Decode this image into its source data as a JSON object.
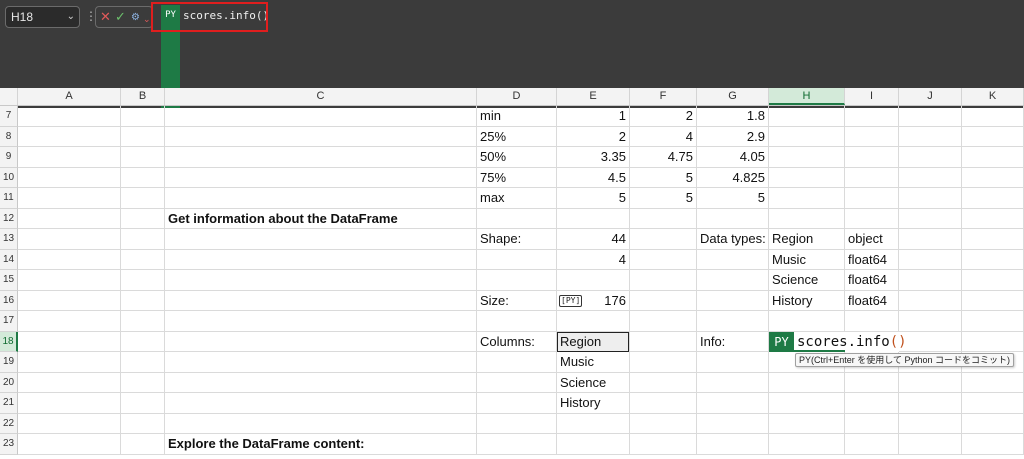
{
  "formula_bar": {
    "name_box": "H18",
    "py_badge": "PY",
    "formula": "scores.info()"
  },
  "columns": [
    "A",
    "B",
    "C",
    "D",
    "E",
    "F",
    "G",
    "H",
    "I",
    "J",
    "K"
  ],
  "selected_column": "H",
  "rows": [
    {
      "num": "7",
      "cells": {
        "D": "min",
        "E": "1",
        "F": "2",
        "G": "1.8"
      }
    },
    {
      "num": "8",
      "cells": {
        "D": "25%",
        "E": "2",
        "F": "4",
        "G": "2.9"
      }
    },
    {
      "num": "9",
      "cells": {
        "D": "50%",
        "E": "3.35",
        "F": "4.75",
        "G": "4.05"
      }
    },
    {
      "num": "10",
      "cells": {
        "D": "75%",
        "E": "4.5",
        "F": "5",
        "G": "4.825"
      }
    },
    {
      "num": "11",
      "cells": {
        "D": "max",
        "E": "5",
        "F": "5",
        "G": "5"
      }
    },
    {
      "num": "12",
      "cells": {
        "C": "Get information about the DataFrame"
      }
    },
    {
      "num": "13",
      "cells": {
        "D": "Shape:",
        "E": "44",
        "G": "Data types:",
        "H": "Region",
        "I": "object"
      }
    },
    {
      "num": "14",
      "cells": {
        "E": "4",
        "H": "Music",
        "I": "float64"
      }
    },
    {
      "num": "15",
      "cells": {
        "H": "Science",
        "I": "float64"
      }
    },
    {
      "num": "16",
      "cells": {
        "D": "Size:",
        "E": "176",
        "H": "History",
        "I": "float64"
      }
    },
    {
      "num": "17",
      "cells": {}
    },
    {
      "num": "18",
      "cells": {
        "D": "Columns:",
        "E": "Region",
        "G": "Info:"
      }
    },
    {
      "num": "19",
      "cells": {
        "E": "Music"
      }
    },
    {
      "num": "20",
      "cells": {
        "E": "Science"
      }
    },
    {
      "num": "21",
      "cells": {
        "E": "History"
      }
    },
    {
      "num": "22",
      "cells": {}
    },
    {
      "num": "23",
      "cells": {
        "C": "Explore the DataFrame content:"
      }
    }
  ],
  "selected_row": "18",
  "size_py_icon": "[PY]",
  "active_cell": {
    "badge": "PY",
    "text_main": "scores.info",
    "text_parens": "()",
    "tooltip": "PY(Ctrl+Enter を使用して Python コードをコミット)"
  }
}
